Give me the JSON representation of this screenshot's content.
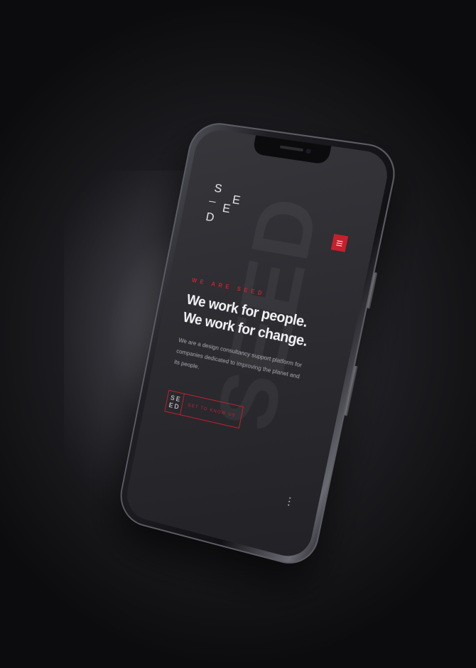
{
  "brand": {
    "logo_letters": [
      "S",
      "E",
      "E",
      "D"
    ],
    "watermark": "SEED",
    "accent_color": "#c5202b"
  },
  "menu": {
    "icon": "hamburger-icon"
  },
  "hero": {
    "eyebrow": "WE ARE SEED",
    "headline_line1": "We work for people.",
    "headline_line2": "We work for change.",
    "body": "We are a design consultancy support platform for companies dedicated to improving the planet and its people."
  },
  "cta": {
    "logo_top": "S E",
    "logo_bottom": "E D",
    "label": "GET TO KNOW US"
  }
}
